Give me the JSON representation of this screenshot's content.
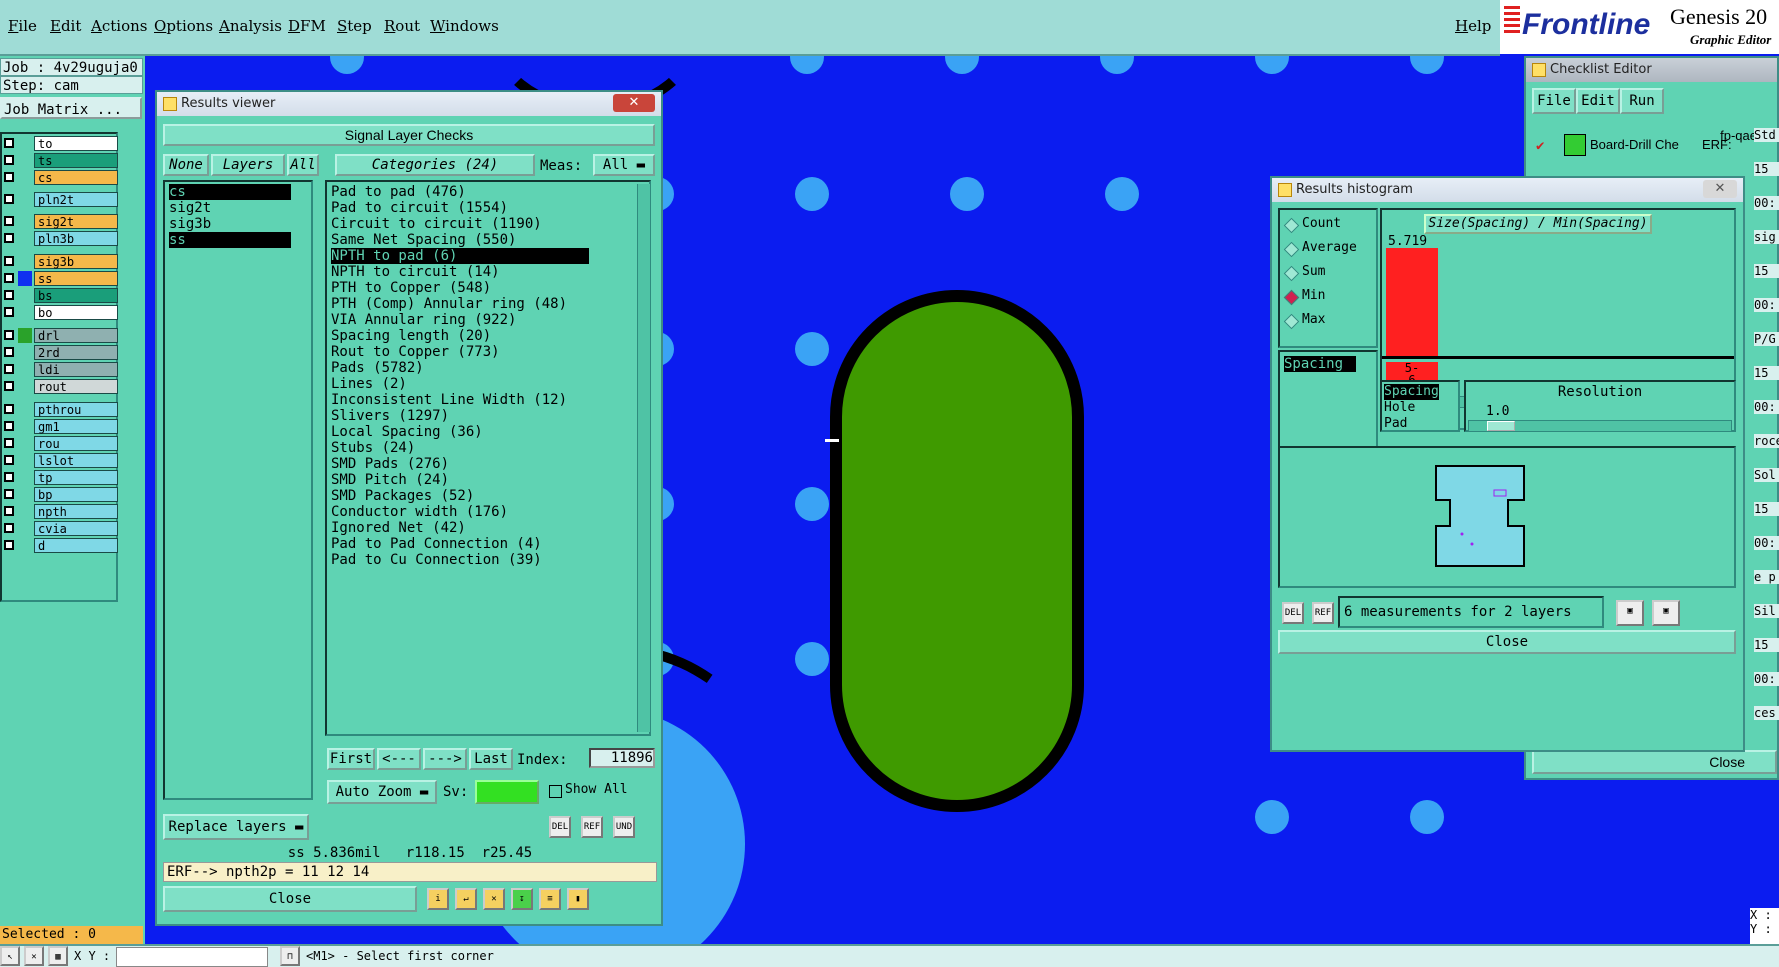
{
  "menubar": {
    "items": [
      "File",
      "Edit",
      "Actions",
      "Options",
      "Analysis",
      "DFM",
      "Step",
      "Rout",
      "Windows"
    ],
    "help": "Help"
  },
  "brand": {
    "logo": "Frontline",
    "product": "Genesis 20",
    "subtitle": "Graphic Editor"
  },
  "leftpanel": {
    "job": "Job : 4v29uguja0",
    "step": "Step: cam",
    "matrix_button": "Job Matrix ...",
    "layers": [
      {
        "name": "to",
        "color": "#ffffff"
      },
      {
        "name": "ts",
        "color": "#1a9e7a"
      },
      {
        "name": "cs",
        "color": "#f5b84a"
      },
      {
        "name": "pln2t",
        "color": "#7fd8e6"
      },
      {
        "name": "sig2t",
        "color": "#f5b84a"
      },
      {
        "name": "pln3b",
        "color": "#7fd8e6"
      },
      {
        "name": "sig3b",
        "color": "#f5b84a"
      },
      {
        "name": "ss",
        "color": "#f5b84a"
      },
      {
        "name": "bs",
        "color": "#1a9e7a"
      },
      {
        "name": "bo",
        "color": "#ffffff"
      },
      {
        "name": "drl",
        "color": "#8fb0b0"
      },
      {
        "name": "2rd",
        "color": "#8fb0b0"
      },
      {
        "name": "ldi",
        "color": "#8fb0b0"
      },
      {
        "name": "rout",
        "color": "#d0d8d8"
      },
      {
        "name": "pthrou",
        "color": "#7fd8e6"
      },
      {
        "name": "gm1",
        "color": "#7fd8e6"
      },
      {
        "name": "rou",
        "color": "#7fd8e6"
      },
      {
        "name": "lslot",
        "color": "#7fd8e6"
      },
      {
        "name": "tp",
        "color": "#7fd8e6"
      },
      {
        "name": "bp",
        "color": "#7fd8e6"
      },
      {
        "name": "npth",
        "color": "#7fd8e6"
      },
      {
        "name": "cvia",
        "color": "#7fd8e6"
      },
      {
        "name": "d",
        "color": "#7fd8e6"
      }
    ],
    "selected": "Selected : 0"
  },
  "results_viewer": {
    "title": "Results viewer",
    "header": "Signal Layer Checks",
    "none_btn": "None",
    "layers_btn": "Layers",
    "all_btn": "All",
    "categories_btn": "Categories (24)",
    "meas_label": "Meas:",
    "meas_value": "All",
    "layer_list": [
      "cs",
      "sig2t",
      "sig3b",
      "ss"
    ],
    "categories": [
      "Pad to pad (476)",
      "Pad to circuit (1554)",
      "Circuit to circuit (1190)",
      "Same Net Spacing (550)",
      "NPTH to pad (6)",
      "NPTH to circuit (14)",
      "PTH to Copper (548)",
      "PTH (Comp) Annular ring (48)",
      "VIA Annular ring (922)",
      "Spacing length (20)",
      "Rout to Copper (773)",
      "Pads (5782)",
      "Lines (2)",
      "Inconsistent Line Width (12)",
      "Slivers (1297)",
      "Local Spacing (36)",
      "Stubs (24)",
      "SMD Pads (276)",
      "SMD Pitch (24)",
      "SMD Packages (52)",
      "Conductor width (176)",
      "Ignored Net (42)",
      "Pad to Pad Connection (4)",
      "Pad to Cu Connection (39)"
    ],
    "nav": {
      "first": "First",
      "prev": "<---",
      "next": "--->",
      "last": "Last",
      "index_label": "Index:",
      "index_value": "11896"
    },
    "auto_zoom": "Auto Zoom",
    "sv_label": "Sv:",
    "show_all": "Show All",
    "replace_layers": "Replace layers",
    "status1": "ss 5.836mil   r118.15  r25.45",
    "status2": "ERF--> npth2p = 11 12 14",
    "close": "Close"
  },
  "checklist_editor": {
    "title": "Checklist Editor",
    "menu": [
      "File",
      "Edit",
      "Run"
    ],
    "name": "fp-qae",
    "row": "Board-Drill Che",
    "erf": "ERF:",
    "close": "Close",
    "side_texts": [
      "Std",
      "15",
      "00:",
      "sig",
      "15",
      "00:",
      "P/G",
      "15",
      "00:",
      "roce",
      "Sol",
      "15",
      "00:",
      "e p",
      "Sil",
      "15",
      "00:",
      "ces"
    ]
  },
  "histogram": {
    "title": "Results histogram",
    "modes": [
      "Count",
      "Average",
      "Sum",
      "Min",
      "Max"
    ],
    "selected_mode": "Min",
    "measure_list": [
      "Spacing"
    ],
    "chart_title": "Size(Spacing) / Min(Spacing)",
    "bar_value": "5.719",
    "bar_label": "5-\n6",
    "type_list": [
      "Spacing",
      "Hole",
      "Pad"
    ],
    "resolution_label": "Resolution",
    "resolution_value": "1.0",
    "status": "6 measurements for 2 layers",
    "close": "Close"
  },
  "bottombar": {
    "xy": "X Y :",
    "hint": "<M1> - Select first corner"
  },
  "corner": {
    "x": "X :",
    "y": "Y :"
  }
}
